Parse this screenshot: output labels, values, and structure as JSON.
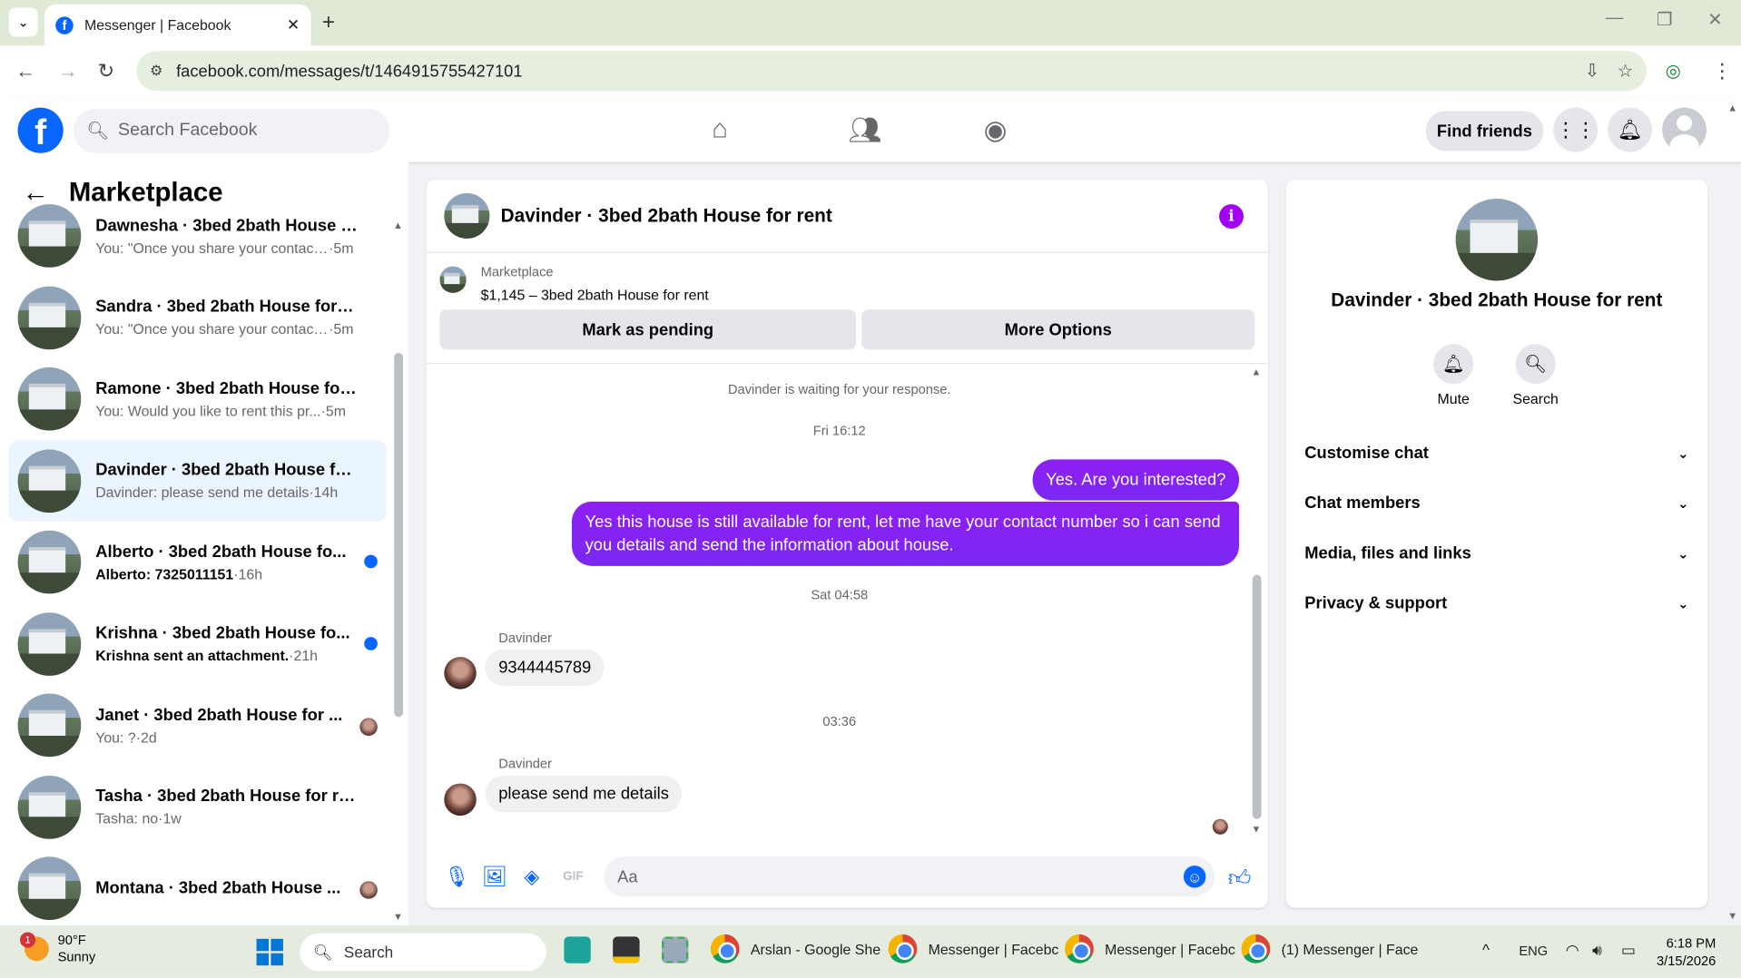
{
  "browser": {
    "tab_title": "Messenger | Facebook",
    "url": "facebook.com/messages/t/1464915755427101"
  },
  "facebook": {
    "search_placeholder": "Search Facebook",
    "find_friends": "Find friends"
  },
  "sidebar": {
    "title": "Marketplace",
    "conversations": [
      {
        "name": "Dawnesha · 3bed 2bath House f...",
        "preview": "You: \"Once you share your contact...",
        "time": "5m",
        "unread": false,
        "indicator": "none"
      },
      {
        "name": "Sandra · 3bed 2bath House for r...",
        "preview": "You: \"Once you share your contact...",
        "time": "5m",
        "unread": false,
        "indicator": "none"
      },
      {
        "name": "Ramone · 3bed 2bath House for...",
        "preview": "You: Would you like to rent this pr...",
        "time": "5m",
        "unread": false,
        "indicator": "none"
      },
      {
        "name": "Davinder · 3bed 2bath House fo...",
        "preview": "Davinder: please send me details",
        "time": "14h",
        "unread": false,
        "indicator": "none",
        "active": true
      },
      {
        "name": "Alberto · 3bed 2bath House fo...",
        "preview": "Alberto: 7325011151",
        "time": "16h",
        "unread": true,
        "indicator": "dot"
      },
      {
        "name": "Krishna · 3bed 2bath House fo...",
        "preview": "Krishna sent an attachment.",
        "time": "21h",
        "unread": true,
        "indicator": "dot"
      },
      {
        "name": "Janet · 3bed 2bath House for ...",
        "preview": "You: ?",
        "time": "2d",
        "unread": false,
        "indicator": "seen"
      },
      {
        "name": "Tasha · 3bed 2bath House for rent",
        "preview": "Tasha: no",
        "time": "1w",
        "unread": false,
        "indicator": "none"
      },
      {
        "name": "Montana · 3bed 2bath House ...",
        "preview": "",
        "time": "",
        "unread": false,
        "indicator": "seen"
      }
    ]
  },
  "chat": {
    "title": "Davinder · 3bed 2bath House for rent",
    "listing_tag": "Marketplace",
    "listing_price": "$1,145 – 3bed 2bath House for rent",
    "btn_pending": "Mark as pending",
    "btn_more": "More Options",
    "waiting_text": "Davinder is waiting for your response.",
    "ts1": "Fri 16:12",
    "out1": "Yes. Are you interested?",
    "out2": "Yes this house is still available for rent, let me have your contact number so i can send you details and send the information about house.",
    "ts2": "Sat 04:58",
    "sender": "Davinder",
    "in1": "9344445789",
    "ts3": "03:36",
    "in2": "please send me details",
    "composer_placeholder": "Aa"
  },
  "details": {
    "title": "Davinder · 3bed 2bath House for rent",
    "mute": "Mute",
    "search": "Search",
    "sections": [
      "Customise chat",
      "Chat members",
      "Media, files and links",
      "Privacy & support"
    ]
  },
  "taskbar": {
    "temp": "90°F",
    "condition": "Sunny",
    "weather_badge": "1",
    "search": "Search",
    "apps": [
      "Arslan - Google She",
      "Messenger | Facebc",
      "Messenger | Facebc",
      "(1) Messenger | Face"
    ],
    "lang": "ENG",
    "time": "6:18 PM",
    "date": "3/15/2026"
  }
}
